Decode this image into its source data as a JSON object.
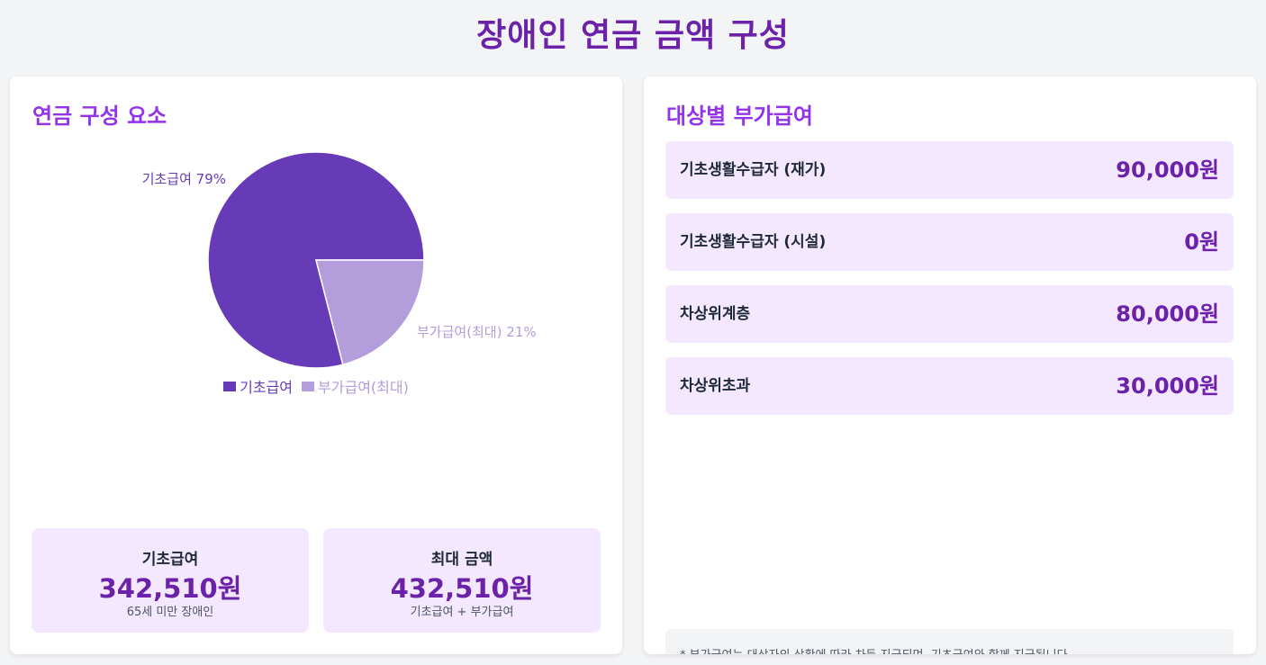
{
  "page": {
    "title": "장애인 연금 금액 구성"
  },
  "left_card": {
    "heading": "연금 구성 요소",
    "stats": [
      {
        "label": "기초급여",
        "value": "342,510원",
        "note": "65세 미만 장애인"
      },
      {
        "label": "최대 금액",
        "value": "432,510원",
        "note": "기초급여 + 부가급여"
      }
    ]
  },
  "right_card": {
    "heading": "대상별 부가급여",
    "rows": [
      {
        "label": "기초생활수급자 (재가)",
        "value": "90,000원"
      },
      {
        "label": "기초생활수급자 (시설)",
        "value": "0원"
      },
      {
        "label": "차상위계층",
        "value": "80,000원"
      },
      {
        "label": "차상위초과",
        "value": "30,000원"
      }
    ],
    "footnote": "* 부가급여는 대상자의 상황에 따라 차등 지급되며, 기초급여와 함께 지급됩니다."
  },
  "colors": {
    "primary": "#6b21a8",
    "heading": "#9333ea",
    "slice_main": "#673ab7",
    "slice_extra": "#b39ddb",
    "box_bg": "#f3e8ff"
  },
  "chart_data": {
    "type": "pie",
    "categories": [
      "기초급여",
      "부가급여(최대)"
    ],
    "values": [
      79,
      21
    ],
    "slice_labels": [
      "기초급여 79%",
      "부가급여(최대) 21%"
    ],
    "colors": [
      "#673ab7",
      "#b39ddb"
    ],
    "legend": "bottom"
  }
}
